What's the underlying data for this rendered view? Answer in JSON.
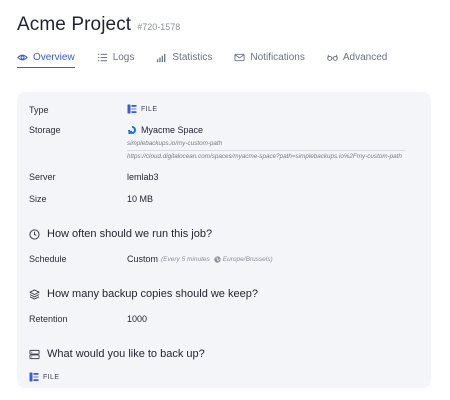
{
  "header": {
    "title": "Acme Project",
    "project_id": "#720-1578"
  },
  "tabs": [
    {
      "label": "Overview",
      "icon": "eye-icon",
      "active": true
    },
    {
      "label": "Logs",
      "icon": "list-icon"
    },
    {
      "label": "Statistics",
      "icon": "bar-chart-icon"
    },
    {
      "label": "Notifications",
      "icon": "mail-icon"
    },
    {
      "label": "Advanced",
      "icon": "glasses-icon"
    }
  ],
  "details": {
    "type_label": "Type",
    "type_value": "FILE",
    "storage_label": "Storage",
    "storage_name": "Myacme Space",
    "storage_path": "simplebackups.io/my-custom-path",
    "storage_url": "https://cloud.digitalocean.com/spaces/myacme-space?path=simplebackups.io%2Fmy-custom-path",
    "server_label": "Server",
    "server_value": "lemlab3",
    "size_label": "Size",
    "size_value": "10 MB"
  },
  "schedule_section": {
    "title": "How often should we run this job?",
    "schedule_label": "Schedule",
    "schedule_value": "Custom",
    "schedule_detail": "(Every 5 minutes",
    "timezone": "Europe/Brussels)"
  },
  "retention_section": {
    "title": "How many backup copies should we keep?",
    "retention_label": "Retention",
    "retention_value": "1000"
  },
  "backup_section": {
    "title": "What would you like to back up?",
    "type_value": "FILE"
  },
  "colors": {
    "accent": "#3b5bdb",
    "card_bg": "#f4f5f8"
  }
}
